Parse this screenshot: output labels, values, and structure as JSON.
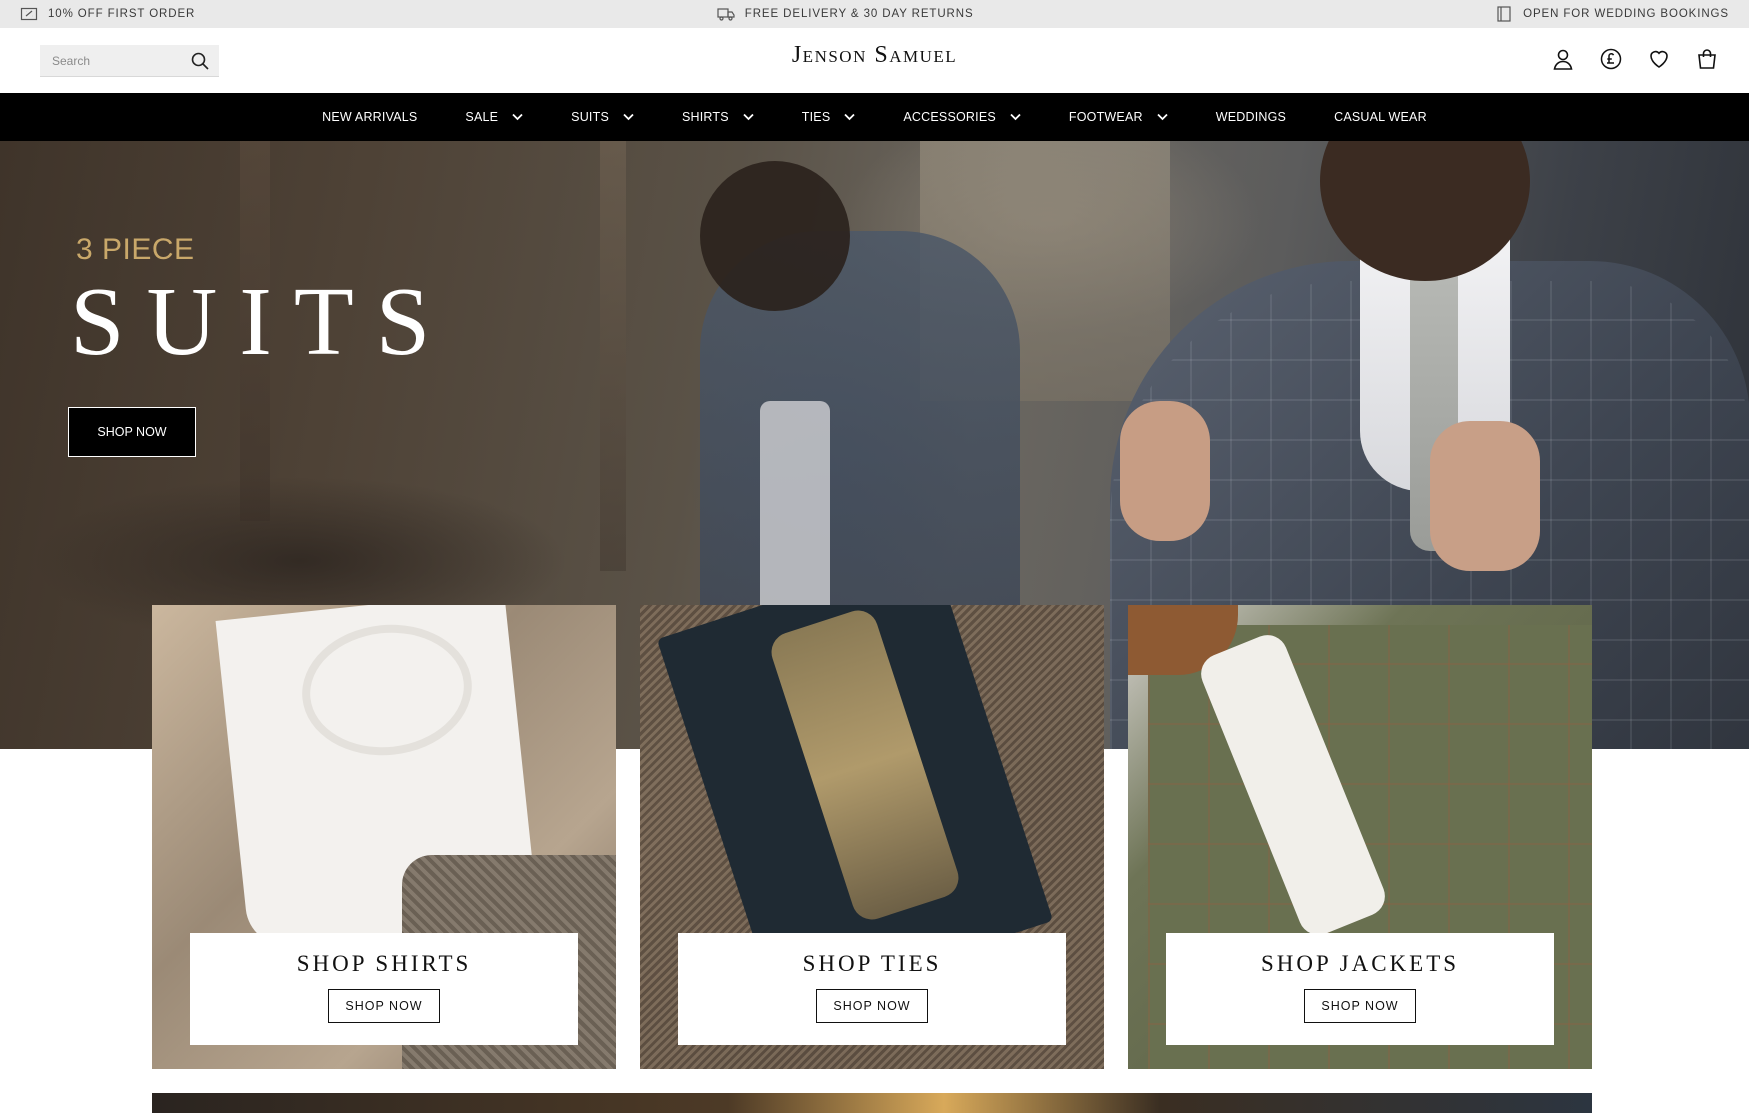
{
  "announcement": {
    "left_text": "10% OFF FIRST ORDER",
    "center_text": "FREE DELIVERY & 30 DAY RETURNS",
    "right_text": "OPEN FOR WEDDING BOOKINGS"
  },
  "header": {
    "search_placeholder": "Search",
    "logo": "Jenson Samuel",
    "icons": [
      "account-icon",
      "currency-pound-icon",
      "wishlist-heart-icon",
      "bag-icon"
    ]
  },
  "nav": {
    "items": [
      {
        "label": "NEW ARRIVALS",
        "dropdown": false
      },
      {
        "label": "SALE",
        "dropdown": true
      },
      {
        "label": "SUITS",
        "dropdown": true
      },
      {
        "label": "SHIRTS",
        "dropdown": true
      },
      {
        "label": "TIES",
        "dropdown": true
      },
      {
        "label": "ACCESSORIES",
        "dropdown": true
      },
      {
        "label": "FOOTWEAR",
        "dropdown": true
      },
      {
        "label": "WEDDINGS",
        "dropdown": false
      },
      {
        "label": "CASUAL WEAR",
        "dropdown": false
      }
    ]
  },
  "hero": {
    "subtitle": "3 PIECE",
    "title": "SUITS",
    "button": "SHOP NOW",
    "accent_color": "#c9a86a"
  },
  "tiles": [
    {
      "title": "SHOP SHIRTS",
      "button": "SHOP NOW"
    },
    {
      "title": "SHOP TIES",
      "button": "SHOP NOW"
    },
    {
      "title": "SHOP JACKETS",
      "button": "SHOP NOW"
    }
  ]
}
